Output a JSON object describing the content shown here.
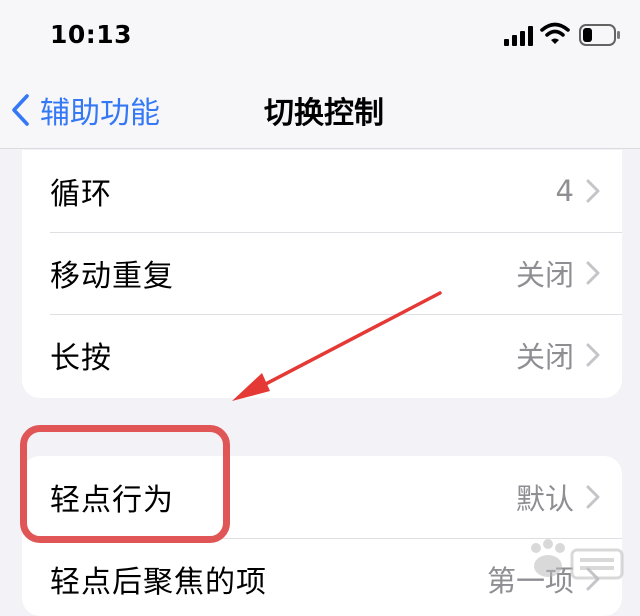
{
  "status_bar": {
    "time": "10:13",
    "icons": [
      "signal-icon",
      "wifi-icon",
      "battery-icon"
    ]
  },
  "nav": {
    "back_label": "辅助功能",
    "title": "切换控制"
  },
  "settings_group_1": [
    {
      "label": "循环",
      "value": "4"
    },
    {
      "label": "移动重复",
      "value": "关闭"
    },
    {
      "label": "长按",
      "value": "关闭"
    }
  ],
  "settings_group_2": [
    {
      "label": "轻点行为",
      "value": "默认"
    },
    {
      "label": "轻点后聚焦的项",
      "value": "第一项"
    }
  ],
  "colors": {
    "accent": "#3478f6",
    "annotation": "#e05555",
    "secondary_text": "#8e8e93",
    "background": "#f2f2f7"
  }
}
